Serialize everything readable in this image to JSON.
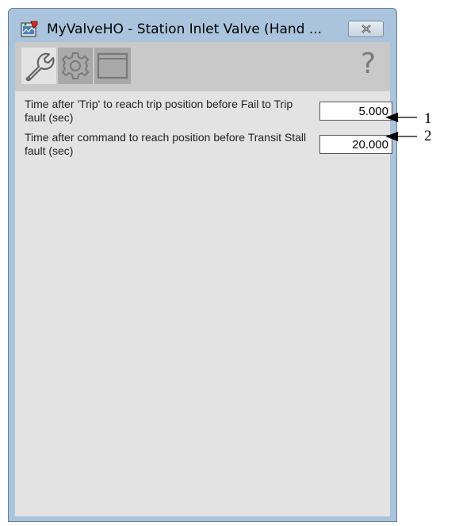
{
  "window": {
    "title": "MyValveHO - Station Inlet Valve (Hand ..."
  },
  "toolbar": {
    "tabs": [
      {
        "name": "wrench-tab",
        "icon": "wrench-icon",
        "active": true
      },
      {
        "name": "gear-tab",
        "icon": "gear-icon",
        "active": false
      },
      {
        "name": "window-tab",
        "icon": "window-icon",
        "active": false
      }
    ],
    "help_label": "?"
  },
  "params": [
    {
      "label": "Time after 'Trip' to reach trip position before Fail to Trip fault (sec)",
      "value": "5.000",
      "callout": "1"
    },
    {
      "label": "Time after command to reach position before Transit Stall fault (sec)",
      "value": "20.000",
      "callout": "2"
    }
  ],
  "colors": {
    "frame": "#a9c4dc",
    "client": "#e3e3e3",
    "toolbar": "#c9c9c9",
    "tab_inactive": "#a9a9a9"
  }
}
